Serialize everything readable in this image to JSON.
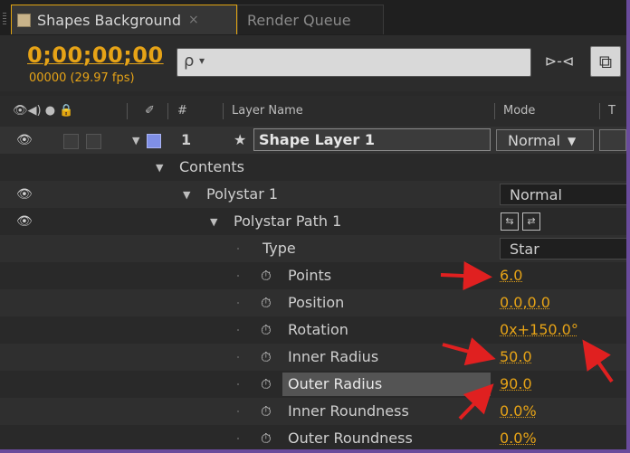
{
  "tabs": [
    {
      "label": "Shapes Background",
      "close": "×",
      "active": true
    },
    {
      "label": "Render Queue",
      "active": false
    }
  ],
  "timecode": {
    "value": "0;00;00;00",
    "frames": "00000 (29.97 fps)"
  },
  "search": {
    "icon": "ρ▾",
    "value": ""
  },
  "header": {
    "number": "#",
    "layer_name": "Layer Name",
    "mode": "Mode",
    "trim": "T"
  },
  "layer": {
    "index": "1",
    "name": "Shape Layer 1",
    "mode": "Normal"
  },
  "contents_label": "Contents",
  "polystar": {
    "label": "Polystar 1",
    "mode": "Normal"
  },
  "polystar_path": {
    "label": "Polystar Path 1"
  },
  "properties": [
    {
      "label": "Type",
      "value": "Star",
      "stopwatch": false,
      "dropdown": true
    },
    {
      "label": "Points",
      "value": "6.0",
      "stopwatch": true
    },
    {
      "label": "Position",
      "value": "0.0,0.0",
      "stopwatch": true
    },
    {
      "label": "Rotation",
      "value": "0x+150.0°",
      "stopwatch": true
    },
    {
      "label": "Inner Radius",
      "value": "50.0",
      "stopwatch": true
    },
    {
      "label": "Outer Radius",
      "value": "90.0",
      "stopwatch": true,
      "selected": true
    },
    {
      "label": "Inner Roundness",
      "value": "0.0%",
      "stopwatch": true
    },
    {
      "label": "Outer Roundness",
      "value": "0.0%",
      "stopwatch": true
    }
  ],
  "colors": {
    "accent": "#e6a317",
    "panel": "#292929",
    "annotation_arrow": "#e02020",
    "label_color": "#7f8fe6"
  }
}
